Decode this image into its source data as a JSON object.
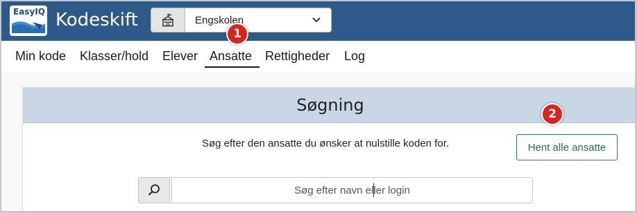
{
  "header": {
    "logo_text": "EasyIQ",
    "app_title": "Kodeskift",
    "school_select": {
      "value": "Engskolen"
    }
  },
  "nav": {
    "items": [
      {
        "label": "Min kode"
      },
      {
        "label": "Klasser/hold"
      },
      {
        "label": "Elever"
      },
      {
        "label": "Ansatte",
        "active": true
      },
      {
        "label": "Rettigheder"
      },
      {
        "label": "Log"
      }
    ]
  },
  "badges": [
    "1",
    "2"
  ],
  "panel": {
    "title": "Søgning",
    "description": "Søg efter den ansatte du ønsker at nulstille koden for.",
    "fetch_all_label": "Hent alle ansatte",
    "search_placeholder": "Søg efter navn eller login"
  },
  "colors": {
    "header_bg": "#2e5a8a",
    "panel_head_bg": "#c9d6e4",
    "badge_red": "#d7261e",
    "button_green": "#2e7d5e"
  }
}
